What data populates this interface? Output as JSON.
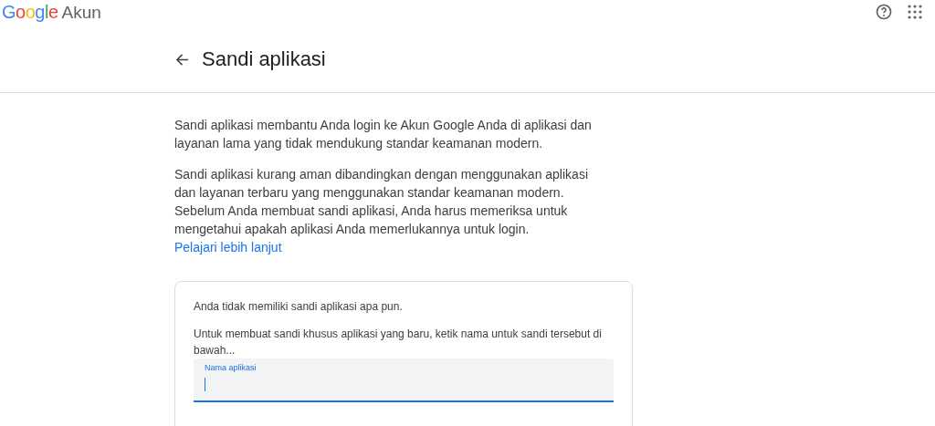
{
  "logo": {
    "letters": [
      {
        "text": "G",
        "color": "#4285f4"
      },
      {
        "text": "o",
        "color": "#ea4335"
      },
      {
        "text": "o",
        "color": "#fbbc05"
      },
      {
        "text": "g",
        "color": "#4285f4"
      },
      {
        "text": "l",
        "color": "#34a853"
      },
      {
        "text": "e",
        "color": "#ea4335"
      }
    ],
    "product": "Akun"
  },
  "page_title": "Sandi aplikasi",
  "paragraphs": [
    "Sandi aplikasi membantu Anda login ke Akun Google Anda di aplikasi dan layanan lama yang tidak mendukung standar keamanan modern.",
    "Sandi aplikasi kurang aman dibandingkan dengan menggunakan aplikasi dan layanan terbaru yang menggunakan standar keamanan modern. Sebelum Anda membuat sandi aplikasi, Anda harus memeriksa untuk mengetahui apakah aplikasi Anda memerlukannya untuk login."
  ],
  "learn_more_link": "Pelajari lebih lanjut",
  "card": {
    "empty_message": "Anda tidak memiliki sandi aplikasi apa pun.",
    "instruction": "Untuk membuat sandi khusus aplikasi yang baru, ketik nama untuk sandi tersebut di bawah...",
    "field": {
      "label": "Nama aplikasi",
      "focused": true
    }
  }
}
